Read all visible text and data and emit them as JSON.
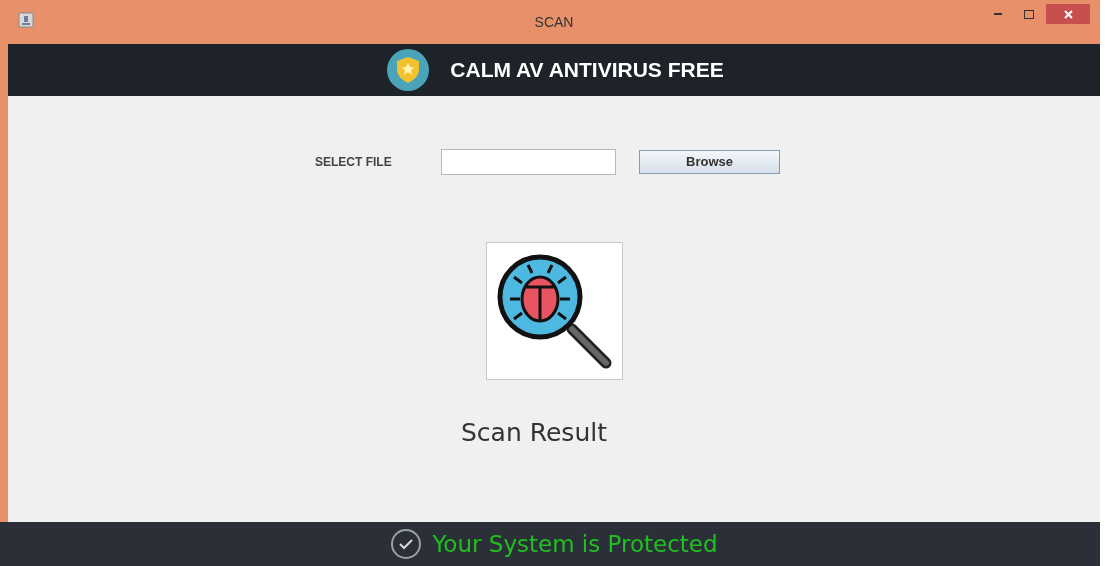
{
  "window": {
    "title": "SCAN"
  },
  "header": {
    "title": "CALM AV ANTIVIRUS FREE"
  },
  "file_select": {
    "label": "SELECT FILE",
    "button": "Browse"
  },
  "scan_result": {
    "label": "Scan Result"
  },
  "status_bar": {
    "text": "Your System is Protected"
  }
}
